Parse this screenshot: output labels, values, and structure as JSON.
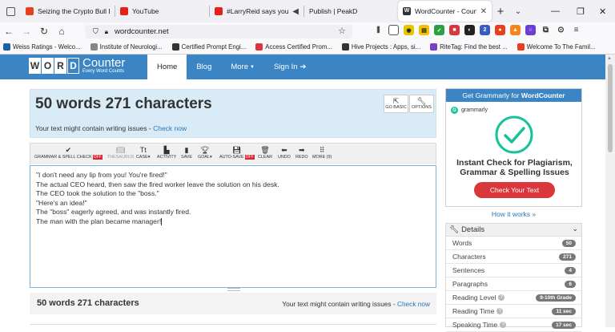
{
  "browser": {
    "tabs": [
      {
        "title": "Seizing the Crypto Bull Ru",
        "color": "#e8401c"
      },
      {
        "title": "YouTube",
        "color": "#e62117"
      },
      {
        "title": "#LarryReid says you d",
        "color": "#e62117"
      },
      {
        "title": "Publish | PeakD",
        "color": ""
      },
      {
        "title": "WordCounter - Count Wo",
        "color": "#333333"
      }
    ],
    "url": "wordcounter.net",
    "bookmarks": [
      {
        "label": "Weiss Ratings - Welco...",
        "color": "#1d5fa8"
      },
      {
        "label": "Institute of Neurologi...",
        "color": "#888888"
      },
      {
        "label": "Certified Prompt Engi...",
        "color": "#333333"
      },
      {
        "label": "Access Certified Prom...",
        "color": "#d9373b"
      },
      {
        "label": "Hive Projects : Apps, si...",
        "color": "#333333"
      },
      {
        "label": "RiteTag: Find the best ...",
        "color": "#7b3fc4"
      },
      {
        "label": "Welcome To The Famil...",
        "color": "#e8401c"
      }
    ]
  },
  "site": {
    "logo_letters": [
      "W",
      "O",
      "R",
      "D"
    ],
    "logo_big": "Counter",
    "logo_small": "Every Word Counts",
    "nav": {
      "home": "Home",
      "blog": "Blog",
      "more": "More",
      "signin": "Sign In"
    }
  },
  "counter": {
    "headline": "50 words 271 characters",
    "warning": "Your text might contain writing issues - ",
    "check_link": "Check now",
    "go_basic": "GO BASIC",
    "options": "OPTIONS"
  },
  "toolbar": {
    "grammar": "GRAMMAR & SPELL CHECK",
    "off": "OFF",
    "thesaurus": "THESAURUS",
    "case": "CASE",
    "activity": "ACTIVITY",
    "save": "SAVE",
    "goal": "GOAL",
    "autosave": "AUTO-SAVE",
    "clear": "CLEAR",
    "undo": "UNDO",
    "redo": "REDO",
    "more": "MORE (9)"
  },
  "editor": {
    "lines": [
      "\"I don't need any lip from you! You're fired!\"",
      "The actual CEO heard, then saw the fired worker leave the solution on his desk.",
      "The CEO took the solution to the \"boss.\"",
      "\"Here's an idea!\"",
      "The \"boss\" eagerly agreed, and was instantly fired.",
      "The man with the plan became manager!"
    ]
  },
  "bottom": {
    "headline": "50 words 271 characters",
    "warning": "Your text might contain writing issues - ",
    "check_link": "Check now"
  },
  "grammarly": {
    "header_prefix": "Get Grammarly for ",
    "header_bold": "WordCounter",
    "brand": "grammarly",
    "title": "Instant Check for Plagiarism, Grammar & Spelling Issues",
    "button": "Check Your Text",
    "how_it_works": "How it works »"
  },
  "details": {
    "title": "Details",
    "rows": [
      {
        "label": "Words",
        "value": "50"
      },
      {
        "label": "Characters",
        "value": "271"
      },
      {
        "label": "Sentences",
        "value": "4"
      },
      {
        "label": "Paragraphs",
        "value": "6"
      },
      {
        "label": "Reading Level",
        "value": "9-10th Grade"
      },
      {
        "label": "Reading Time",
        "value": "11 sec"
      },
      {
        "label": "Speaking Time",
        "value": "17 sec"
      }
    ]
  },
  "colors": {
    "accent": "#3b85c4",
    "danger": "#d9373b",
    "link": "#2b76b9"
  }
}
